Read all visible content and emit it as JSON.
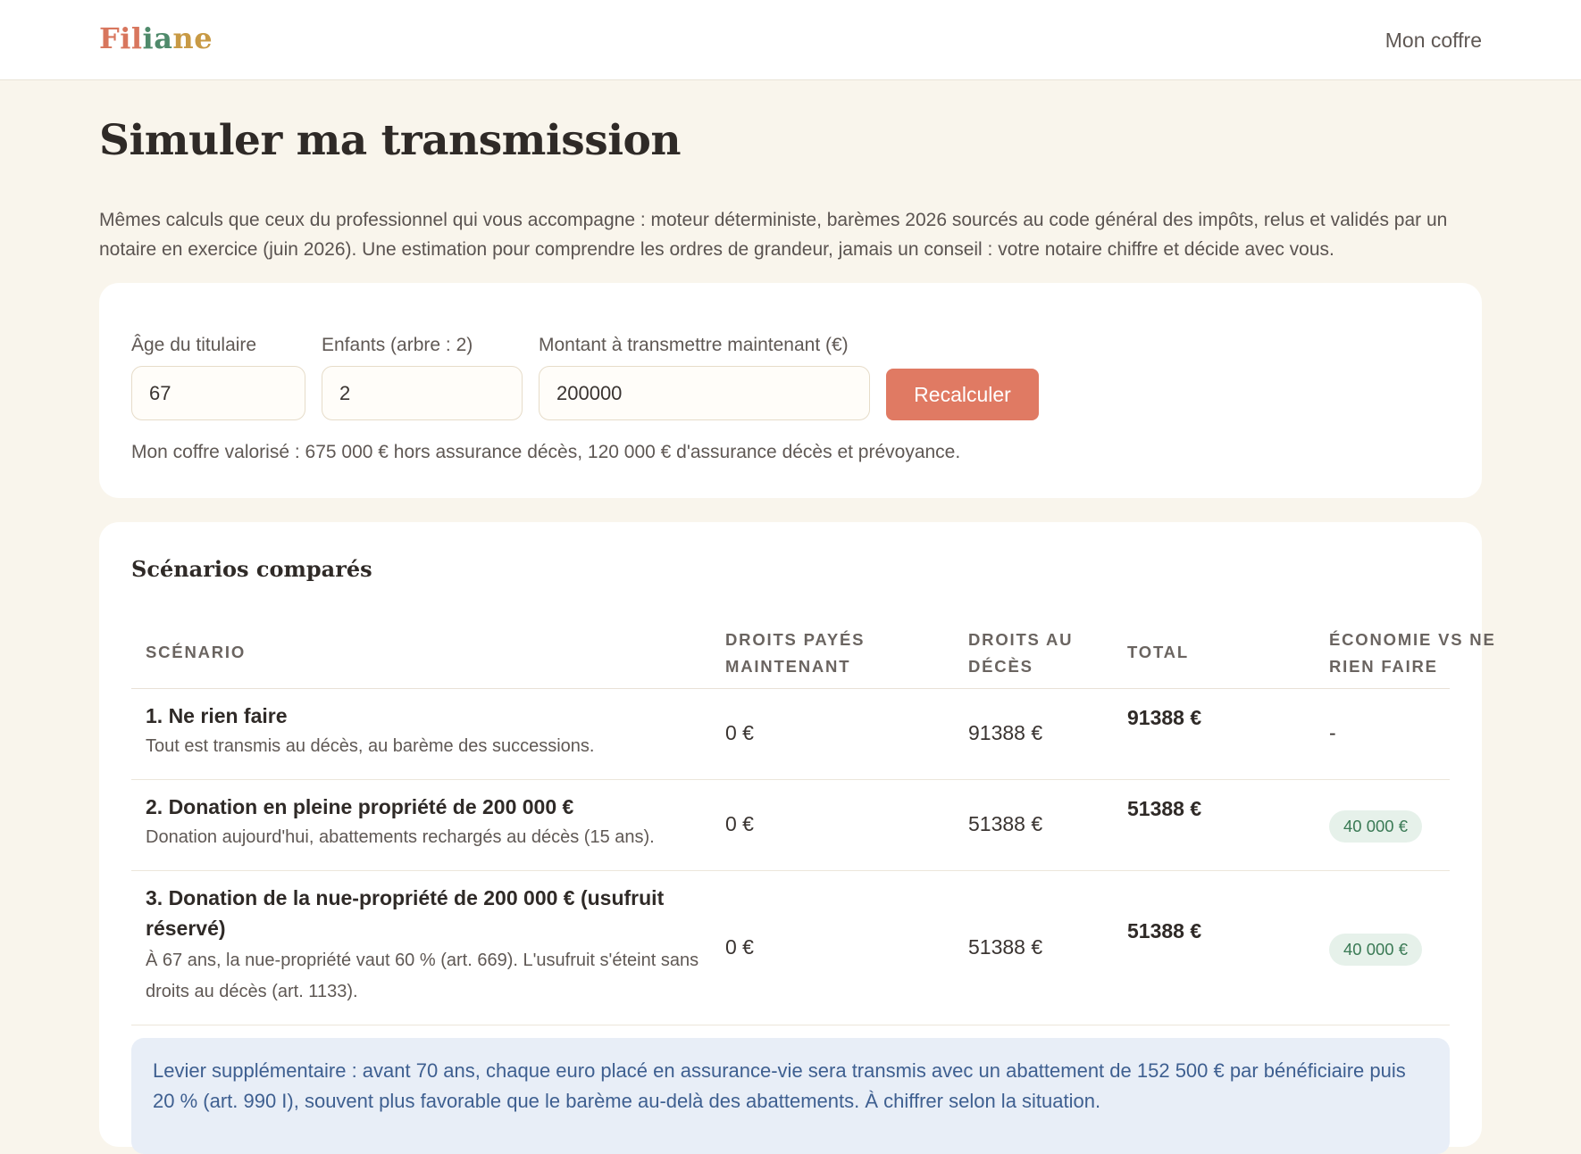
{
  "header": {
    "logo_parts": [
      "Fil",
      "ia",
      "ne"
    ],
    "nav_link": "Mon coffre"
  },
  "page": {
    "title": "Simuler ma transmission",
    "intro": "Mêmes calculs que ceux du professionnel qui vous accompagne : moteur déterministe, barèmes 2026 sourcés au code général des impôts, relus et validés par un notaire en exercice (juin 2026). Une estimation pour comprendre les ordres de grandeur, jamais un conseil : votre notaire chiffre et décide avec vous."
  },
  "form": {
    "age_label": "Âge du titulaire",
    "age_value": "67",
    "children_label": "Enfants (arbre : 2)",
    "children_value": "2",
    "amount_label": "Montant à transmettre maintenant (€)",
    "amount_value": "200000",
    "submit_label": "Recalculer",
    "summary": "Mon coffre valorisé : 675 000 € hors assurance décès, 120 000 € d'assurance décès et prévoyance."
  },
  "table": {
    "title": "Scénarios comparés",
    "headers": {
      "scenario": "Scénario",
      "paid_now": "Droits payés maintenant",
      "at_death": "Droits au décès",
      "total": "Total",
      "saving": "Économie vs ne rien faire"
    },
    "rows": [
      {
        "title": "1. Ne rien faire",
        "desc": "Tout est transmis au décès, au barème des successions.",
        "paid_now": "0 €",
        "at_death": "91388 €",
        "total": "91388 €",
        "saving": "-"
      },
      {
        "title": "2. Donation en pleine propriété de 200 000 €",
        "desc": "Donation aujourd'hui, abattements rechargés au décès (15 ans).",
        "paid_now": "0 €",
        "at_death": "51388 €",
        "total": "51388 €",
        "saving": "40 000 €"
      },
      {
        "title": "3. Donation de la nue-propriété de 200 000 € (usufruit réservé)",
        "desc": "À 67 ans, la nue-propriété vaut 60 % (art. 669). L'usufruit s'éteint sans droits au décès (art. 1133).",
        "paid_now": "0 €",
        "at_death": "51388 €",
        "total": "51388 €",
        "saving": "40 000 €"
      }
    ],
    "notice": "Levier supplémentaire : avant 70 ans, chaque euro placé en assurance-vie sera transmis avec un abattement de 152 500 € par bénéficiaire puis 20 % (art. 990 I), souvent plus favorable que le barème au-delà des abattements. À chiffrer selon la situation."
  }
}
